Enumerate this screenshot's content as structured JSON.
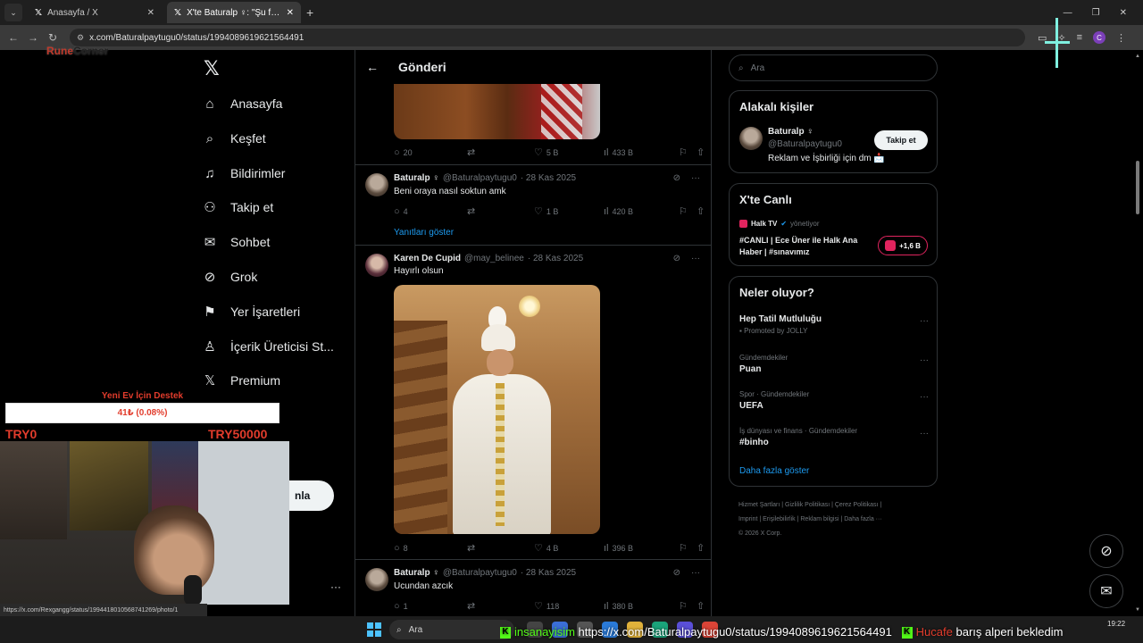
{
  "browser": {
    "tabs": [
      {
        "label": "Anasayfa / X",
        "icon": "x-icon",
        "active": false
      },
      {
        "label": "X'te Baturalp ♀: \"Şu fotonun ark",
        "icon": "x-icon",
        "active": true
      }
    ],
    "url": "x.com/Baturalpaytugu0/status/1994089619621564491"
  },
  "leftnav": {
    "items": [
      {
        "label": "Anasayfa",
        "icon": "home-icon"
      },
      {
        "label": "Keşfet",
        "icon": "search-icon"
      },
      {
        "label": "Bildirimler",
        "icon": "bell-icon"
      },
      {
        "label": "Takip et",
        "icon": "follow-icon"
      },
      {
        "label": "Sohbet",
        "icon": "mail-icon"
      },
      {
        "label": "Grok",
        "icon": "grok-icon"
      },
      {
        "label": "Yer İşaretleri",
        "icon": "bookmark-icon"
      },
      {
        "label": "İçerik Üreticisi St...",
        "icon": "creator-icon"
      },
      {
        "label": "Premium",
        "icon": "x-premium-icon"
      }
    ],
    "post_button_partial": "nla",
    "more": "···"
  },
  "center": {
    "header_title": "Gönderi",
    "first_actions": {
      "replies": "20",
      "likes": "5 B",
      "views": "433 B"
    },
    "tweets": [
      {
        "name": "Baturalp ♀",
        "handle": "@Baturalpaytugu0",
        "date": "· 28 Kas 2025",
        "text": "Beni oraya nasıl soktun amk",
        "replies": "4",
        "likes": "1 B",
        "views": "420 B"
      },
      {
        "name": "Karen De Cupid",
        "handle": "@may_belinee",
        "date": "· 28 Kas 2025",
        "text": "Hayırlı olsun",
        "replies": "8",
        "likes": "4 B",
        "views": "396 B"
      },
      {
        "name": "Baturalp ♀",
        "handle": "@Baturalpaytugu0",
        "date": "· 28 Kas 2025",
        "text": "Ucundan azcık",
        "replies": "1",
        "likes": "118",
        "views": "380 B"
      }
    ],
    "show_replies": "Yanıtları göster"
  },
  "right": {
    "search_placeholder": "Ara",
    "related": {
      "title": "Alakalı kişiler",
      "name": "Baturalp ♀",
      "handle": "@Baturalpaytugu0",
      "bio": "Reklam ve İşbirliği için dm 📩",
      "follow": "Takip et"
    },
    "live": {
      "title": "X'te Canlı",
      "host": "Halk TV",
      "host_role": "yönetiyor",
      "stream_title": "#CANLI | Ece Üner ile Halk Ana Haber | #sınavımız",
      "listeners": "+1,6 B"
    },
    "trends": {
      "title": "Neler oluyor?",
      "items": [
        {
          "context": "",
          "topic": "Hep Tatil Mutluluğu",
          "sub": "Promoted by JOLLY"
        },
        {
          "context": "Gündemdekiler",
          "topic": "Puan",
          "sub": ""
        },
        {
          "context": "Spor · Gündemdekiler",
          "topic": "UEFA",
          "sub": ""
        },
        {
          "context": "İş dünyası ve finans · Gündemdekiler",
          "topic": "#binho",
          "sub": ""
        }
      ],
      "show_more": "Daha fazla göster"
    },
    "footer": {
      "line1": "Hizmet Şartları | Gizlilik Politikası | Çerez Politikası |",
      "line2": "Imprint | Erişilebilirlik | Reklam bilgisi | Daha fazla ···",
      "line3": "© 2026 X Corp."
    }
  },
  "overlay": {
    "brand_a": "Rune",
    "brand_b": "Corner",
    "donation_title": "Yeni Ev İçin Destek",
    "donation_amount": "41₺ (0.08%)",
    "donation_progress": 0.0008,
    "donation_min": "TRY0",
    "donation_max": "TRY50000",
    "status_url": "https://x.com/Rexgangg/status/1994418010568741269/photo/1"
  },
  "taskbar": {
    "search": "Ara",
    "ticker_user1": "insanayisim",
    "ticker_url": "https://x.com/Baturalpaytugu0/status/1994089619621564491",
    "ticker_user2": "Hucafe",
    "ticker_msg": "barış alperi bekledim",
    "time": "19:22"
  }
}
